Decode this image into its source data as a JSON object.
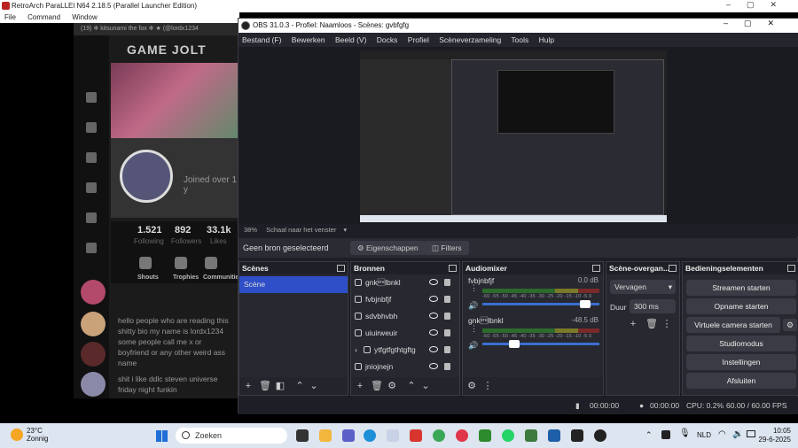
{
  "retroarch": {
    "title": "RetroArch ParaLLEl N64 2.18.5 (Parallel Launcher Edition)",
    "menu": [
      "File",
      "Command",
      "Window"
    ]
  },
  "browser": {
    "tab_text": "(19) ❄ kitsunami the fox ❄ ★ (@lordx1234",
    "logo": "GAME JOLT",
    "joined": "Joined over 1 y",
    "stats": [
      {
        "num": "1.521",
        "label": "Following"
      },
      {
        "num": "892",
        "label": "Followers"
      },
      {
        "num": "33.1k",
        "label": "Likes"
      }
    ],
    "shortcuts": [
      "Shouts",
      "Trophies",
      "Communities"
    ],
    "bio": "hello people who are reading this shitty bio my name is lordx1234 some people call me x or boyfriend or any other weird ass name",
    "bio2": "shit i like ddlc steven universe friday night funkin"
  },
  "obs": {
    "title": "OBS 31.0.3 - Profiel: Naamloos - Scènes: gvbfgfg",
    "menu": [
      "Bestand (F)",
      "Bewerken",
      "Beeld (V)",
      "Docks",
      "Profiel",
      "Scèneverzameling",
      "Tools",
      "Hulp"
    ],
    "zoom": "38%",
    "scale_label": "Schaal naar het venster",
    "no_source": "Geen bron geselecteerd",
    "properties_btn": "Eigenschappen",
    "filters_btn": "Filters",
    "scenes": {
      "title": "Scènes",
      "items": [
        "Scène"
      ]
    },
    "sources": {
      "title": "Bronnen",
      "items": [
        "gnk\u0002lbnkl",
        "fvbjnbfjf",
        "sdvbhvbh",
        "uiuirweuir",
        "ytfgtfgthtgftg",
        "jniojnejn"
      ]
    },
    "mixer": {
      "title": "Audiomixer",
      "tracks": [
        {
          "name": "fvbjnbfjf",
          "db": "0.0 dB",
          "level": 0.92
        },
        {
          "name": "gnk\u0002lbnkl",
          "db": "-48.5 dB",
          "level": 0.25
        }
      ],
      "scale": "-60 -55 -50 -45 -40 -35 -30 -25 -20 -15 -10 -5 0"
    },
    "transitions": {
      "title": "Scène-overgan...",
      "type": "Vervagen",
      "duration_label": "Duur",
      "duration": "300 ms"
    },
    "controls": {
      "title": "Bedieningselementen",
      "buttons": [
        "Streamen starten",
        "Opname starten",
        "Virtuele camera starten",
        "Studiomodus",
        "Instellingen",
        "Afsluiten"
      ]
    },
    "status": {
      "stream_time": "00:00:00",
      "rec_time": "00:00:00",
      "cpu": "CPU: 0.2%",
      "fps": "60.00 / 60.00 FPS"
    }
  },
  "taskbar": {
    "temp": "23°C",
    "weather": "Zonnig",
    "search": "Zoeken",
    "lang": "NLD",
    "time": "10:05",
    "date": "29-6-2025"
  },
  "colors": {
    "obs_bg": "#1e1f26",
    "accent": "#3b6fd1",
    "scene_selected": "#2e4fc7"
  }
}
